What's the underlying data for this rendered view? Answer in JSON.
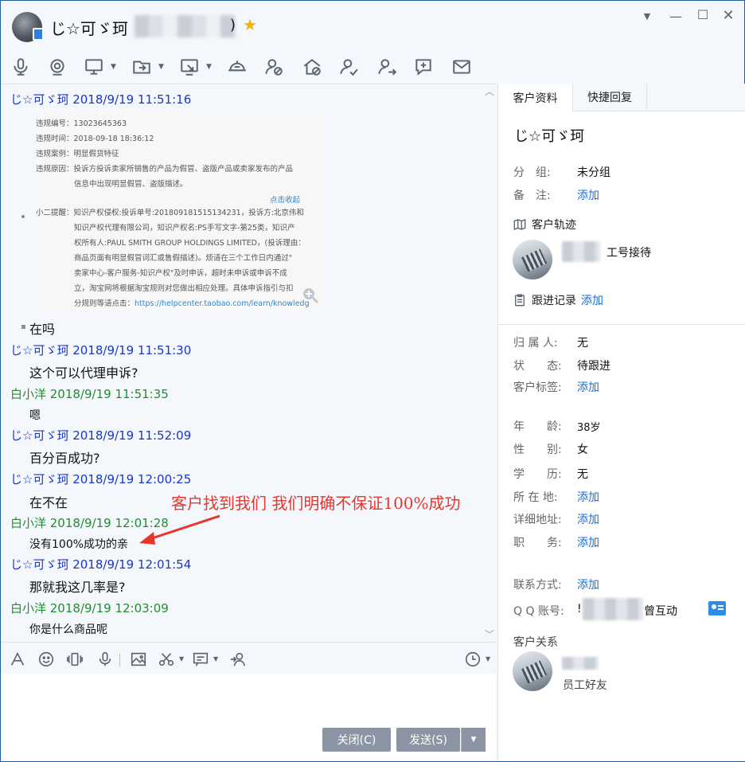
{
  "window": {
    "contact_name": "じ☆可ゞ珂",
    "title_suffix": ")",
    "star_icon": "★"
  },
  "toolbar": {
    "items": [
      "voice-call",
      "video-call",
      "screen-share",
      "send-file",
      "remote-assist",
      "app-center",
      "contact-status",
      "shop",
      "user-check",
      "user-transfer",
      "add-comment",
      "email"
    ]
  },
  "chat": {
    "image_card": {
      "lines": [
        "违规编号：13023645363",
        "违规时间：2018-09-18 18:36:12",
        "违规案例：明显假货特征",
        "违规原因：投诉方投诉卖家所销售的产品为假冒、盗版产品或卖家发布的产品",
        "信息中出现明显假冒、盗版描述。"
      ],
      "collapse_link": "点击收起",
      "tip_lines": [
        "小二提醒：知识产权侵权:投诉单号:2018091815151342​31，投诉方:北京伟和",
        "知识产权代理有限公司，知识产权名:PS手写文字-第25类，知识产",
        "权所有人:PAUL SMITH GROUP HOLDINGS LIMITED，(投诉理由：",
        "商品页面有明显假冒词汇或售假描述)。烦请在三个工作日内通过\"",
        "卖家中心-客户服务-知识产权\"及时申诉，超时未申诉或申诉不成",
        "立，淘宝网将根据淘宝规则对您做出相应处理。具体申诉指引与扣",
        "分规则等请点击："
      ],
      "tip_link": "https://helpcenter.taobao.com/learn/knowledg"
    },
    "messages": [
      {
        "type": "customer",
        "header": "じ☆可ゞ珂 2018/9/19 11:51:16"
      },
      {
        "type": "text",
        "text": "在吗"
      },
      {
        "type": "customer",
        "header": "じ☆可ゞ珂 2018/9/19 11:51:30"
      },
      {
        "type": "text",
        "text": "这个可以代理申诉?"
      },
      {
        "type": "agent",
        "header": "白小洋 2018/9/19 11:51:35"
      },
      {
        "type": "text",
        "text": "嗯"
      },
      {
        "type": "customer",
        "header": "じ☆可ゞ珂 2018/9/19 11:52:09"
      },
      {
        "type": "text",
        "text": "百分百成功?"
      },
      {
        "type": "customer",
        "header": "じ☆可ゞ珂 2018/9/19 12:00:25"
      },
      {
        "type": "text",
        "text": "在不在"
      },
      {
        "type": "agent",
        "header": "白小洋 2018/9/19 12:01:28"
      },
      {
        "type": "text",
        "text": "没有100%成功的亲"
      },
      {
        "type": "customer",
        "header": "じ☆可ゞ珂 2018/9/19 12:01:54"
      },
      {
        "type": "text",
        "text": "那就我这几率是?"
      },
      {
        "type": "agent",
        "header": "白小洋 2018/9/19 12:03:09"
      },
      {
        "type": "text",
        "text": "你是什么商品呢"
      }
    ],
    "annotation": "客户找到我们  我们明确不保证100%成功",
    "annotation_color": "#e8352e"
  },
  "composer": {
    "close_label": "关闭(C)",
    "send_label": "发送(S)"
  },
  "panel": {
    "tabs": [
      "客户资料",
      "快捷回复"
    ],
    "name": "じ☆可ゞ珂",
    "group_label": "分　组:",
    "group_value": "未分组",
    "note_label": "备　注:",
    "note_value": "添加",
    "track_title": "客户轨迹",
    "track_agent": "工号接待",
    "follow_title": "跟进记录",
    "follow_add": "添加",
    "owner_label": "归 属 人:",
    "owner_value": "无",
    "status_label": "状　　态:",
    "status_value": "待跟进",
    "tag_label": "客户标签:",
    "tag_value": "添加",
    "age_label": "年　　龄:",
    "age_value": "38岁",
    "gender_label": "性　　别:",
    "gender_value": "女",
    "edu_label": "学　　历:",
    "edu_value": "无",
    "location_label": "所 在 地:",
    "location_value": "添加",
    "address_label": "详细地址:",
    "address_value": "添加",
    "job_label": "职　　务:",
    "job_value": "添加",
    "contact_label": "联系方式:",
    "contact_value": "添加",
    "qq_label": "Q Q 账号:",
    "qq_prefix": "!",
    "qq_suffix": "曾互动",
    "relation_title": "客户关系",
    "relation_desc": "员工好友"
  },
  "colors": {
    "customer_header": "#1a37c8",
    "agent_header": "#1f8f2e",
    "link": "#1a6fd6",
    "accent": "#2e8be6"
  }
}
